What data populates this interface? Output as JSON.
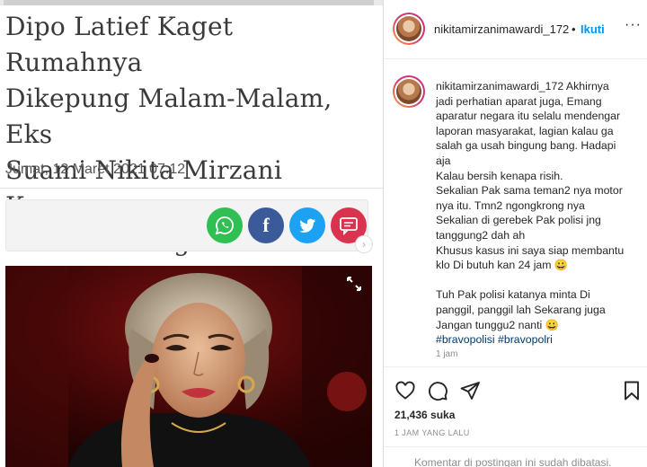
{
  "article": {
    "headline_lines": [
      "Dipo Latief Kaget Rumahnya",
      "Dikepung Malam-Malam, Eks",
      "Suami Nikita Mirzani Kecewa:",
      "Polisi Kok Begitu?"
    ],
    "date": "Jumat, 12 Maret 2021 07:12",
    "share": {
      "facebook_glyph": "f"
    },
    "colors": {
      "whatsapp": "#2fbf52",
      "facebook": "#3b5a9a",
      "twitter": "#1da1f2",
      "comment": "#d9334f"
    }
  },
  "post": {
    "header": {
      "username": "nikitamirzanimawardi_172",
      "separator": "•",
      "follow_label": "Ikuti",
      "more_label": "···"
    },
    "caption": {
      "username": "nikitamirzanimawardi_172",
      "lines": [
        "Akhirnya",
        "jadi perhatian aparat juga, Emang",
        "aparatur negara itu selalu mendengar",
        "laporan masyarakat, lagian kalau ga",
        "salah ga usah bingung bang. Hadapi",
        "aja",
        "Kalau bersih kenapa risih.",
        "Sekalian Pak sama teman2 nya motor",
        "nya itu. Tmn2 ngongkrong nya",
        "Sekalian di gerebek Pak polisi jng",
        "tanggung2 dah ah",
        "Khusus kasus ini saya siap membantu",
        "klo Di butuh kan 24 jam 😀"
      ],
      "lines2": [
        "Tuh Pak polisi katanya minta Di",
        "panggil, panggil lah Sekarang juga",
        "Jangan tunggu2 nanti 😀"
      ],
      "hashtags": "#bravopolisi #bravopolri",
      "time": "1 jam"
    },
    "likes": "21,436 suka",
    "posted": "1 JAM YANG LALU",
    "comments_disabled": "Komentar di postingan ini sudah dibatasi."
  }
}
